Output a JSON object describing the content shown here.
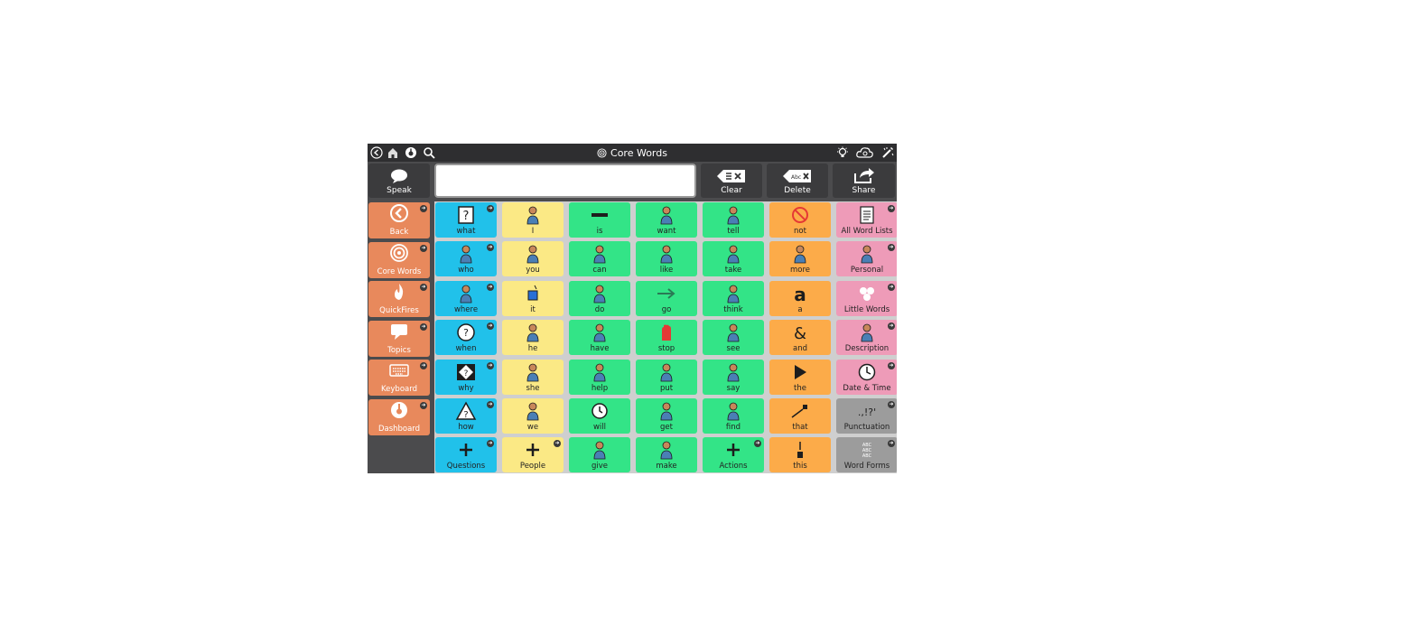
{
  "topbar": {
    "title": "Core Words",
    "icons": [
      "back-circle-icon",
      "home-icon",
      "dashboard-icon",
      "search-icon",
      "lightbulb-icon",
      "cloud-sync-icon",
      "edit-settings-icon"
    ]
  },
  "toolbar": {
    "speak_label": "Speak",
    "clear_label": "Clear",
    "delete_label": "Delete",
    "share_label": "Share",
    "message_value": ""
  },
  "sidebar": {
    "items": [
      {
        "label": "Back",
        "icon": "back-arrow-icon"
      },
      {
        "label": "Core Words",
        "icon": "target-icon"
      },
      {
        "label": "QuickFires",
        "icon": "flame-icon"
      },
      {
        "label": "Topics",
        "icon": "speech-bubble-icon"
      },
      {
        "label": "Keyboard",
        "icon": "keyboard-icon"
      },
      {
        "label": "Dashboard",
        "icon": "dashboard-icon"
      }
    ]
  },
  "colors": {
    "blue": "#21c1ea",
    "yellow": "#fbe985",
    "green": "#33e487",
    "orange": "#fcab49",
    "pink": "#ee9bb8",
    "gray": "#9c9c9c",
    "sidebar": "#e8895c"
  },
  "grid": {
    "columns": [
      {
        "color": "blue",
        "cells": [
          "what",
          "who",
          "where",
          "when",
          "why",
          "how",
          "Questions"
        ]
      },
      {
        "color": "yellow",
        "cells": [
          "I",
          "you",
          "it",
          "he",
          "she",
          "we",
          "People"
        ]
      },
      {
        "color": "green",
        "cells": [
          "is",
          "can",
          "do",
          "have",
          "help",
          "will",
          "give"
        ]
      },
      {
        "color": "green",
        "cells": [
          "want",
          "like",
          "go",
          "stop",
          "put",
          "get",
          "make"
        ]
      },
      {
        "color": "green",
        "cells": [
          "tell",
          "take",
          "think",
          "see",
          "say",
          "find",
          "Actions"
        ]
      },
      {
        "color": "orange",
        "cells": [
          "not",
          "more",
          "a",
          "and",
          "the",
          "that",
          "this"
        ]
      },
      {
        "color": "pink",
        "cells": [
          "All Word Lists",
          "Personal",
          "Little Words",
          "Description",
          "Date & Time",
          "Punctuation",
          "Word Forms"
        ]
      }
    ]
  }
}
